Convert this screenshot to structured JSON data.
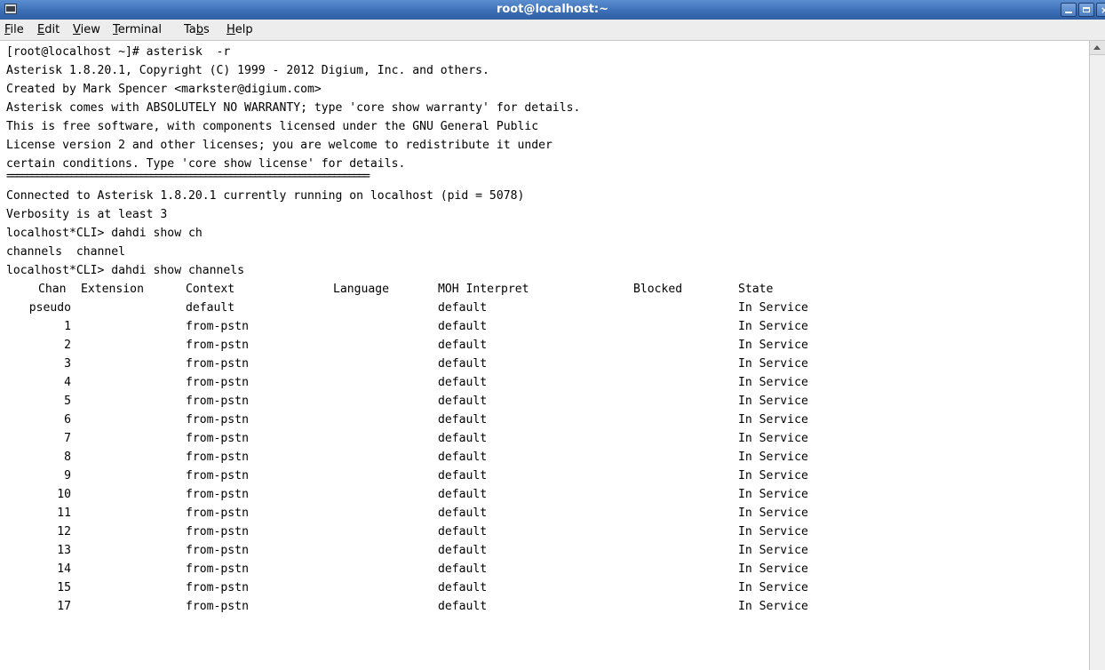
{
  "window": {
    "title": "root@localhost:~"
  },
  "menu": [
    {
      "pre": "",
      "key": "F",
      "post": "ile"
    },
    {
      "pre": "",
      "key": "E",
      "post": "dit"
    },
    {
      "pre": "",
      "key": "V",
      "post": "iew"
    },
    {
      "pre": "",
      "key": "T",
      "post": "erminal"
    },
    {
      "pre": "Ta",
      "key": "b",
      "post": "s"
    },
    {
      "pre": "",
      "key": "H",
      "post": "elp"
    }
  ],
  "terminal": {
    "lines": [
      "[root@localhost ~]# asterisk  -r",
      "Asterisk 1.8.20.1, Copyright (C) 1999 - 2012 Digium, Inc. and others.",
      "Created by Mark Spencer <markster@digium.com>",
      "Asterisk comes with ABSOLUTELY NO WARRANTY; type 'core show warranty' for details.",
      "This is free software, with components licensed under the GNU General Public",
      "License version 2 and other licenses; you are welcome to redistribute it under",
      "certain conditions. Type 'core show license' for details.",
      "=========================================================================",
      "Connected to Asterisk 1.8.20.1 currently running on localhost (pid = 5078)",
      "Verbosity is at least 3",
      "localhost*CLI> dahdi show ch",
      "channels  channel",
      "localhost*CLI> dahdi show channels"
    ],
    "table": {
      "headers": {
        "chan": "Chan",
        "extension": "Extension",
        "context": "Context",
        "language": "Language",
        "moh": "MOH Interpret",
        "blocked": "Blocked",
        "state": "State"
      },
      "rows": [
        {
          "chan": "pseudo",
          "context": "default",
          "moh": "default",
          "state": "In Service"
        },
        {
          "chan": "1",
          "context": "from-pstn",
          "moh": "default",
          "state": "In Service"
        },
        {
          "chan": "2",
          "context": "from-pstn",
          "moh": "default",
          "state": "In Service"
        },
        {
          "chan": "3",
          "context": "from-pstn",
          "moh": "default",
          "state": "In Service"
        },
        {
          "chan": "4",
          "context": "from-pstn",
          "moh": "default",
          "state": "In Service"
        },
        {
          "chan": "5",
          "context": "from-pstn",
          "moh": "default",
          "state": "In Service"
        },
        {
          "chan": "6",
          "context": "from-pstn",
          "moh": "default",
          "state": "In Service"
        },
        {
          "chan": "7",
          "context": "from-pstn",
          "moh": "default",
          "state": "In Service"
        },
        {
          "chan": "8",
          "context": "from-pstn",
          "moh": "default",
          "state": "In Service"
        },
        {
          "chan": "9",
          "context": "from-pstn",
          "moh": "default",
          "state": "In Service"
        },
        {
          "chan": "10",
          "context": "from-pstn",
          "moh": "default",
          "state": "In Service"
        },
        {
          "chan": "11",
          "context": "from-pstn",
          "moh": "default",
          "state": "In Service"
        },
        {
          "chan": "12",
          "context": "from-pstn",
          "moh": "default",
          "state": "In Service"
        },
        {
          "chan": "13",
          "context": "from-pstn",
          "moh": "default",
          "state": "In Service"
        },
        {
          "chan": "14",
          "context": "from-pstn",
          "moh": "default",
          "state": "In Service"
        },
        {
          "chan": "15",
          "context": "from-pstn",
          "moh": "default",
          "state": "In Service"
        },
        {
          "chan": "17",
          "context": "from-pstn",
          "moh": "default",
          "state": "In Service"
        }
      ]
    }
  }
}
